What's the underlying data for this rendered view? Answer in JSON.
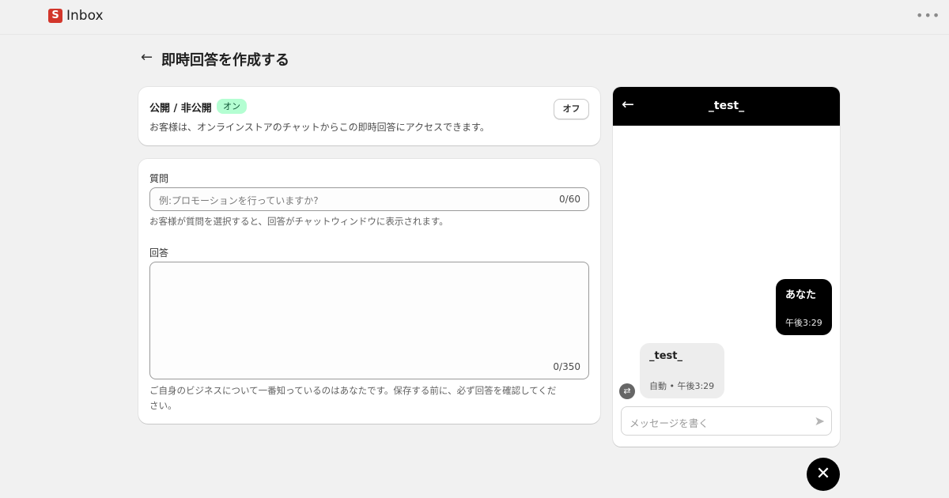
{
  "app": {
    "logo_letter": "S",
    "title": "Inbox",
    "more_icon": "more-horizontal-icon"
  },
  "page": {
    "title": "即時回答を作成する"
  },
  "publish": {
    "label": "公開 / 非公開",
    "status_badge": "オン",
    "description": "お客様は、オンラインストアのチャットからこの即時回答にアクセスできます。",
    "toggle_button": "オフ"
  },
  "question": {
    "label": "質問",
    "placeholder": "例:プロモーションを行っていますか?",
    "counter": "0/60",
    "help": "お客様が質問を選択すると、回答がチャットウィンドウに表示されます。"
  },
  "answer": {
    "label": "回答",
    "counter": "0/350",
    "help_line1": "ご自身のビジネスについて一番知っているのはあなたです。保存する前に、必ず回答を確認してくだ",
    "help_line2": "さい。"
  },
  "chat": {
    "title": "_test_",
    "user_message": "あなた",
    "user_time": "午後3:29",
    "bot_message": "_test_",
    "bot_meta": "自動 • 午後3:29",
    "input_placeholder": "メッセージを書く"
  },
  "colors": {
    "badge_bg": "#b4fed2",
    "chat_header": "#000000",
    "logo": "#d2362b"
  }
}
